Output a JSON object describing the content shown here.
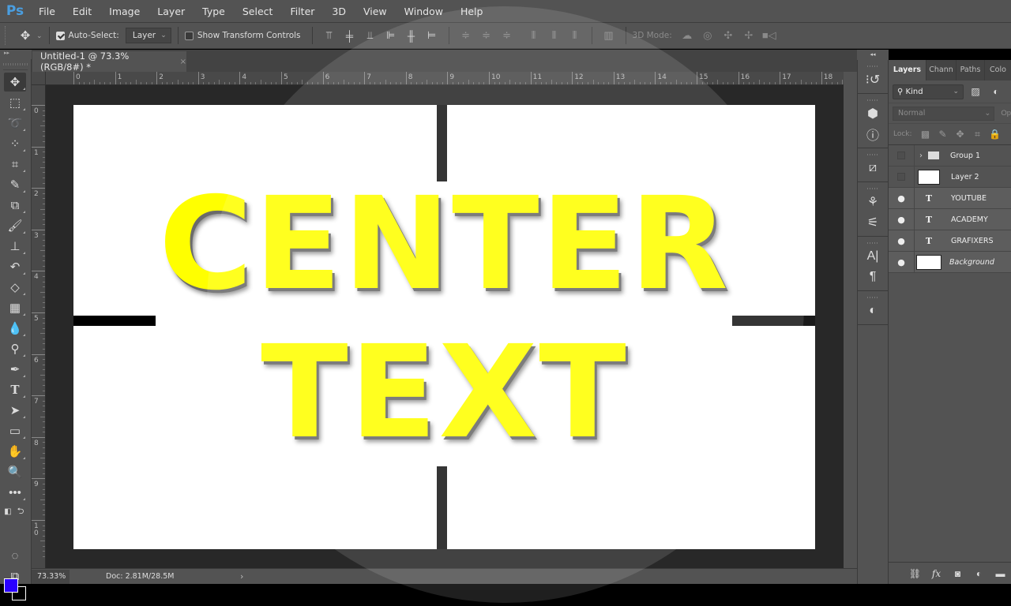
{
  "app": {
    "logo": "Ps"
  },
  "menu": [
    "File",
    "Edit",
    "Image",
    "Layer",
    "Type",
    "Select",
    "Filter",
    "3D",
    "View",
    "Window",
    "Help"
  ],
  "options": {
    "auto_select_label": "Auto-Select:",
    "auto_select_checked": true,
    "target_value": "Layer",
    "show_transform_label": "Show Transform Controls",
    "show_transform_checked": false,
    "mode_3d_label": "3D Mode:"
  },
  "document": {
    "tab_title": "Untitled-1 @ 73.3% (RGB/8#) *",
    "close_glyph": "×",
    "canvas_words": [
      "CENTER",
      "TEXT"
    ],
    "text_color": "#ffff00"
  },
  "rulers": {
    "horizontal": [
      "0",
      "1",
      "2",
      "3",
      "4",
      "5",
      "6",
      "7",
      "8",
      "9",
      "10",
      "11",
      "12",
      "13",
      "14",
      "15",
      "16",
      "17",
      "18"
    ],
    "vertical": [
      "0",
      "1",
      "2",
      "3",
      "4",
      "5",
      "6",
      "7",
      "8",
      "9",
      "10"
    ]
  },
  "status": {
    "zoom": "73.33%",
    "doc_info": "Doc: 2.81M/28.5M",
    "arrow": "›"
  },
  "colors": {
    "foreground": "#2a00ff",
    "background": "#000000"
  },
  "panels": {
    "tabs": [
      "Layers",
      "Chann",
      "Paths",
      "Colo"
    ],
    "active_tab": "Layers",
    "filter_kind": "Kind",
    "blend_mode": "Normal",
    "opacity_label": "Op",
    "lock_label": "Lock:",
    "layers": [
      {
        "name": "Group 1",
        "type": "group",
        "visible": false
      },
      {
        "name": "Layer 2",
        "type": "pixel",
        "visible": false
      },
      {
        "name": "YOUTUBE",
        "type": "text",
        "visible": true
      },
      {
        "name": "ACADEMY",
        "type": "text",
        "visible": true
      },
      {
        "name": "GRAFIXERS",
        "type": "text",
        "visible": true
      },
      {
        "name": "Background",
        "type": "background",
        "visible": true
      }
    ]
  },
  "icons": {
    "collapse_left": "▸▸",
    "collapse_right": "◂◂",
    "eye": "●",
    "text_layer": "T",
    "chevron_down": "⌄"
  }
}
